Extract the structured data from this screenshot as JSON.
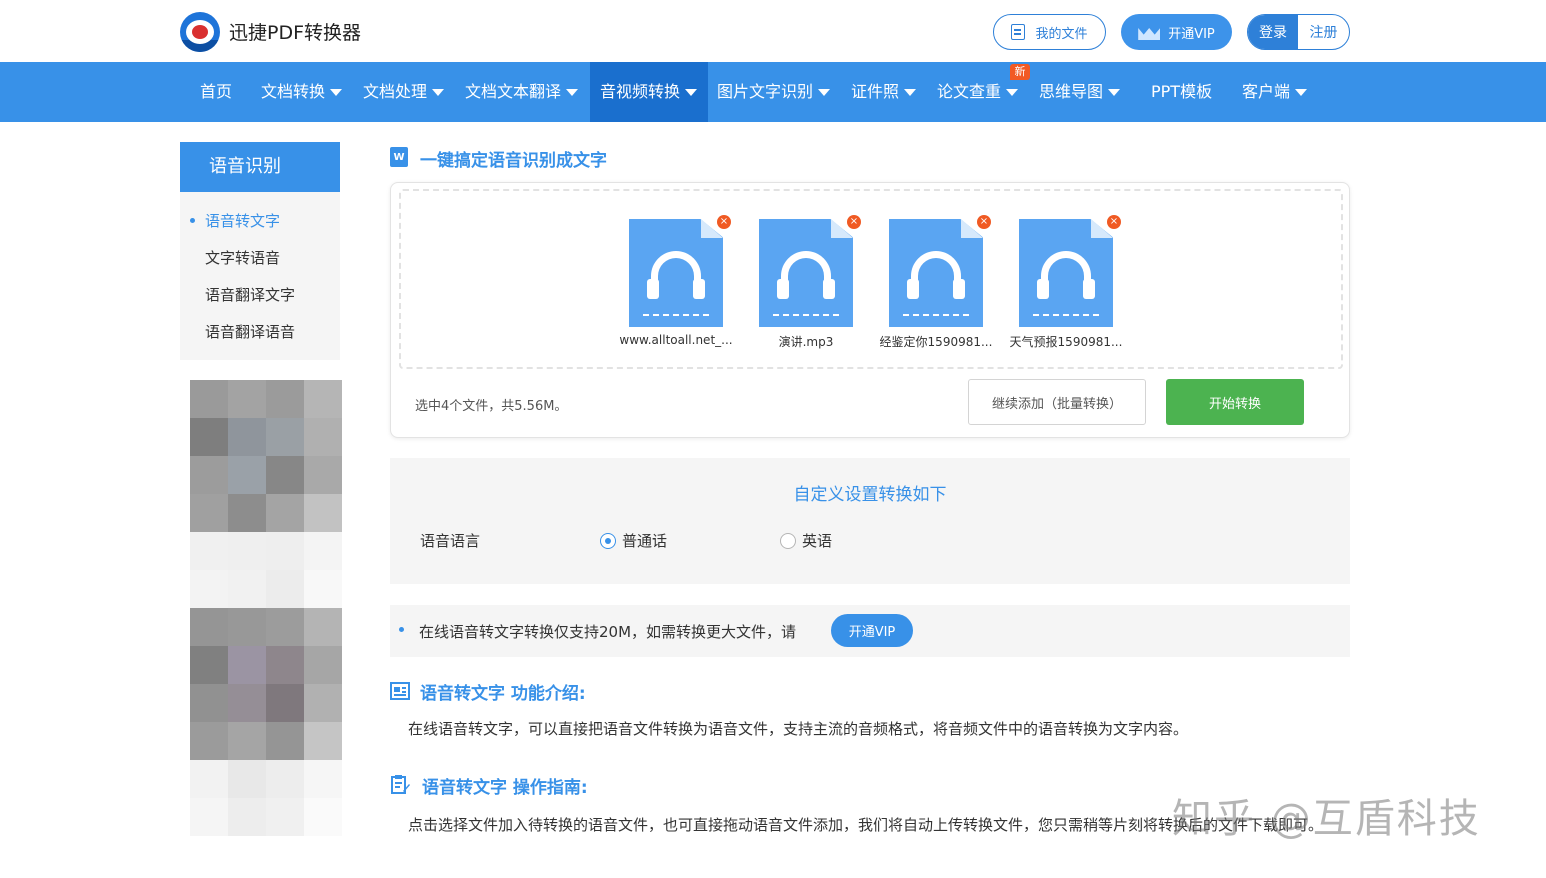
{
  "brand": {
    "name": "迅捷PDF转换器"
  },
  "topbar": {
    "my_files": "我的文件",
    "vip": "开通VIP",
    "login": "登录",
    "register": "注册"
  },
  "nav": {
    "items": [
      {
        "label": "首页"
      },
      {
        "label": "文档转换"
      },
      {
        "label": "文档处理"
      },
      {
        "label": "文档文本翻译"
      },
      {
        "label": "音视频转换"
      },
      {
        "label": "图片文字识别"
      },
      {
        "label": "证件照"
      },
      {
        "label": "论文查重"
      },
      {
        "label": "思维导图"
      },
      {
        "label": "PPT模板"
      },
      {
        "label": "客户端"
      }
    ],
    "active": "音视频转换",
    "new_badge": "新"
  },
  "sidebar": {
    "title": "语音识别",
    "items": [
      {
        "label": "语音转文字"
      },
      {
        "label": "文字转语音"
      },
      {
        "label": "语音翻译文字"
      },
      {
        "label": "语音翻译语音"
      }
    ],
    "active": "语音转文字"
  },
  "main": {
    "title": "一键搞定语音识别成文字",
    "word_icon": "W",
    "files": [
      {
        "name": "www.alltoall.net_..."
      },
      {
        "name": "演讲.mp3"
      },
      {
        "name": "经鉴定你1590981..."
      },
      {
        "name": "天气预报1590981..."
      }
    ],
    "close_glyph": "×",
    "selection_info": "选中4个文件，共5.56M。",
    "add_button": "继续添加（批量转换）",
    "start_button": "开始转换"
  },
  "settings": {
    "title": "自定义设置转换如下",
    "label": "语音语言",
    "options": [
      {
        "label": "普通话",
        "checked": true
      },
      {
        "label": "英语",
        "checked": false
      }
    ]
  },
  "notice": {
    "text": "在线语音转文字转换仅支持20M，如需转换更大文件，请",
    "button": "开通VIP"
  },
  "intro": {
    "title": "语音转文字 功能介绍:",
    "text": "在线语音转文字，可以直接把语音文件转换为语音文件，支持主流的音频格式，将音频文件中的语音转换为文字内容。"
  },
  "guide": {
    "title": "语音转文字 操作指南:",
    "text": "点击选择文件加入待转换的语音文件，也可直接拖动语音文件添加，我们将自动上传转换文件，您只需稍等片刻将转换后的文件下载即可。"
  },
  "watermark": "知乎 @互盾科技",
  "colors": {
    "primary": "#3891e8",
    "nav_active": "#1a6fce",
    "start_green": "#4cb350",
    "close_orange": "#f05a23"
  }
}
